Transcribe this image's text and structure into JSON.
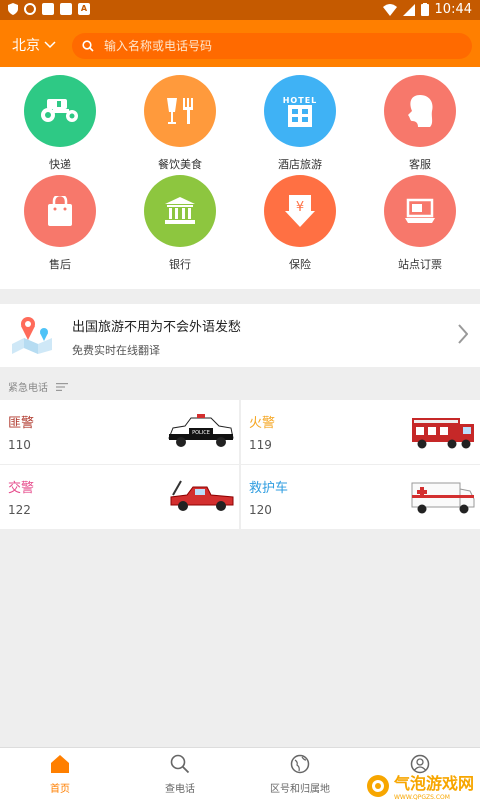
{
  "status_bar": {
    "time": "10:44"
  },
  "header": {
    "city": "北京",
    "search_placeholder": "输入名称或电话号码"
  },
  "grid": [
    {
      "label": "快递",
      "color": "#2ec985",
      "icon": "tractor-icon"
    },
    {
      "label": "餐饮美食",
      "color": "#ff9a3c",
      "icon": "fork-cup-icon"
    },
    {
      "label": "酒店旅游",
      "color": "#3fb2f5",
      "icon": "hotel-icon",
      "icon_text": "HOTEL"
    },
    {
      "label": "客服",
      "color": "#f7786b",
      "icon": "person-head-icon"
    },
    {
      "label": "售后",
      "color": "#f7786b",
      "icon": "shopping-bag-icon"
    },
    {
      "label": "银行",
      "color": "#8dc63f",
      "icon": "bank-icon"
    },
    {
      "label": "保险",
      "color": "#ff7043",
      "icon": "yen-shield-icon",
      "icon_text": "¥"
    },
    {
      "label": "站点订票",
      "color": "#f7786b",
      "icon": "laptop-icon"
    }
  ],
  "promo": {
    "title": "出国旅游不用为不会外语发愁",
    "subtitle": "免费实时在线翻译"
  },
  "section": {
    "title": "紧急电话"
  },
  "emergency": [
    {
      "name": "匪警",
      "number": "110",
      "color": "#b03a2e",
      "car": "police-car",
      "car_text": "POLICE"
    },
    {
      "name": "火警",
      "number": "119",
      "color": "#f5a623",
      "car": "fire-truck"
    },
    {
      "name": "交警",
      "number": "122",
      "color": "#e64c8c",
      "car": "tow-truck"
    },
    {
      "name": "救护车",
      "number": "120",
      "color": "#2f9de0",
      "car": "ambulance"
    }
  ],
  "tabs": [
    {
      "label": "首页",
      "icon": "home-icon",
      "active": true
    },
    {
      "label": "查电话",
      "icon": "search-phone-icon",
      "active": false
    },
    {
      "label": "区号和归属地",
      "icon": "globe-icon",
      "active": false
    },
    {
      "label": "",
      "icon": "user-icon",
      "active": false
    }
  ],
  "watermark": {
    "text": "气泡游戏网",
    "sub": "WWW.QPGZS.COM"
  },
  "colors": {
    "brand": "#ff7f00",
    "active_tab": "#ff7f00"
  }
}
